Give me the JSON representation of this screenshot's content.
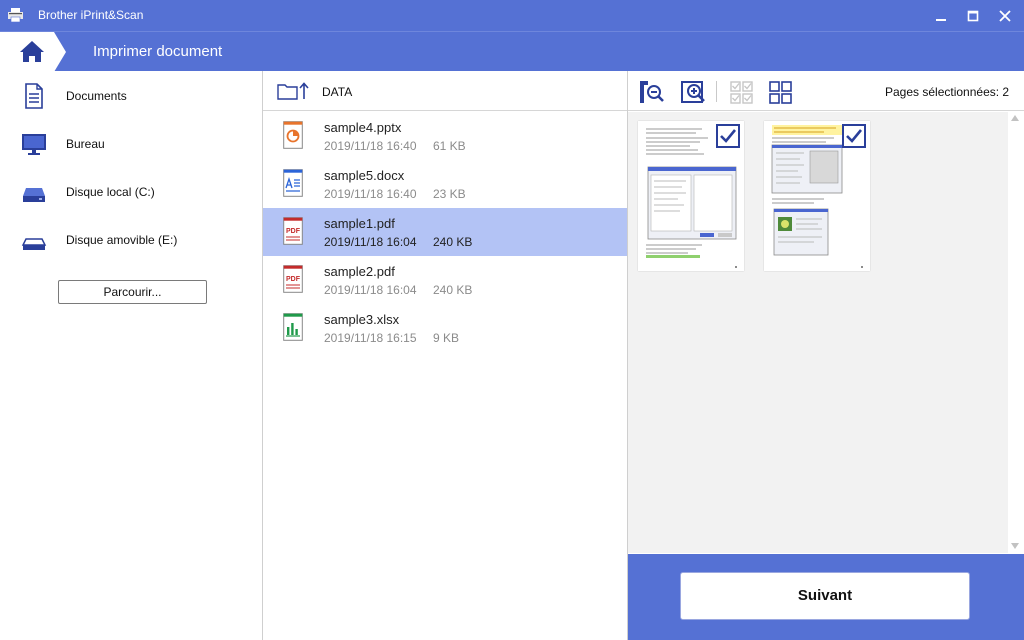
{
  "app": {
    "title": "Brother iPrint&Scan"
  },
  "header": {
    "title": "Imprimer document"
  },
  "sidebar": {
    "items": [
      {
        "label": "Documents",
        "icon": "document-icon"
      },
      {
        "label": "Bureau",
        "icon": "monitor-icon"
      },
      {
        "label": "Disque local (C:)",
        "icon": "hard-drive-icon"
      },
      {
        "label": "Disque amovible (E:)",
        "icon": "removable-drive-icon"
      }
    ],
    "browse_label": "Parcourir..."
  },
  "folder": {
    "name": "DATA"
  },
  "files": [
    {
      "name": "sample4.pptx",
      "date": "2019/11/18 16:40",
      "size": "61 KB",
      "type": "pptx"
    },
    {
      "name": "sample5.docx",
      "date": "2019/11/18 16:40",
      "size": "23 KB",
      "type": "docx"
    },
    {
      "name": "sample1.pdf",
      "date": "2019/11/18 16:04",
      "size": "240 KB",
      "type": "pdf",
      "selected": true
    },
    {
      "name": "sample2.pdf",
      "date": "2019/11/18 16:04",
      "size": "240 KB",
      "type": "pdf"
    },
    {
      "name": "sample3.xlsx",
      "date": "2019/11/18 16:15",
      "size": "9 KB",
      "type": "xlsx"
    }
  ],
  "preview": {
    "pages_selected_label": "Pages sélectionnées: 2",
    "pages": [
      {
        "checked": true
      },
      {
        "checked": true
      }
    ]
  },
  "footer": {
    "next_label": "Suivant"
  },
  "icons": {
    "pdf": "PDF"
  },
  "colors": {
    "accent": "#5571d4",
    "selected_row": "#b3c3f5",
    "icon_blue": "#2a3f9a"
  }
}
